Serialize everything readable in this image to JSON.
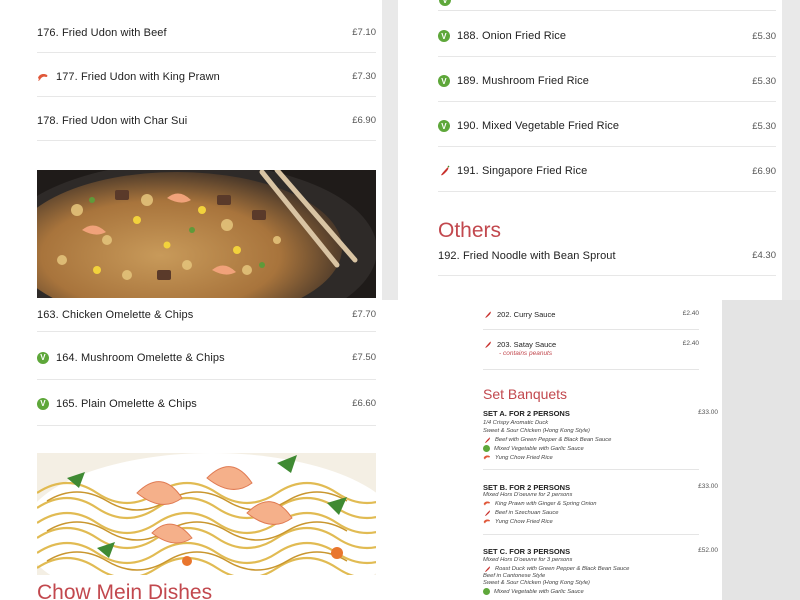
{
  "panel_left": {
    "items_top": [
      {
        "name": "176. Fried Udon with Beef",
        "price": "£7.10",
        "icon": ""
      },
      {
        "name": "177. Fried Udon with King Prawn",
        "price": "£7.30",
        "icon": "prawn-icon"
      },
      {
        "name": "178. Fried Udon with Char Sui",
        "price": "£6.90",
        "icon": ""
      }
    ],
    "items_bottom": [
      {
        "name": "163. Chicken Omelette & Chips",
        "price": "£7.70",
        "icon": ""
      },
      {
        "name": "164. Mushroom Omelette & Chips",
        "price": "£7.50",
        "icon": "vegetarian-icon"
      },
      {
        "name": "165. Plain Omelette & Chips",
        "price": "£6.60",
        "icon": "vegetarian-icon"
      }
    ],
    "section_title": "Chow Mein Dishes"
  },
  "panel_right": {
    "items": [
      {
        "name": "188. Onion Fried Rice",
        "price": "£5.30",
        "icon": "vegetarian-icon"
      },
      {
        "name": "189. Mushroom Fried Rice",
        "price": "£5.30",
        "icon": "vegetarian-icon"
      },
      {
        "name": "190. Mixed Vegetable Fried Rice",
        "price": "£5.30",
        "icon": "vegetarian-icon"
      },
      {
        "name": "191. Singapore Fried Rice",
        "price": "£6.90",
        "icon": "chili-icon"
      }
    ],
    "section_title": "Others",
    "others_items": [
      {
        "name": "192. Fried Noodle with Bean Sprout",
        "price": "£4.30"
      }
    ]
  },
  "panel_small": {
    "sauces": [
      {
        "name": "202. Curry Sauce",
        "price": "£2.40",
        "note": ""
      },
      {
        "name": "203. Satay Sauce",
        "price": "£2.40",
        "note": "- contains peanuts"
      }
    ],
    "section_title": "Set Banquets",
    "banquets": [
      {
        "title": "SET A. FOR 2 PERSONS",
        "price": "£33.00",
        "lines": [
          {
            "text": "1/4 Crispy Aromatic Duck",
            "icon": ""
          },
          {
            "text": "Sweet & Sour Chicken (Hong Kong Style)",
            "icon": ""
          },
          {
            "text": "Beef with Green Pepper & Black Bean Sauce",
            "icon": "chili-icon"
          },
          {
            "text": "Mixed Vegetable with Garlic Sauce",
            "icon": "vegetarian-icon"
          },
          {
            "text": "Yung Chow Fried Rice",
            "icon": "prawn-icon"
          }
        ]
      },
      {
        "title": "SET B. FOR 2 PERSONS",
        "price": "£33.00",
        "lines": [
          {
            "text": "Mixed Hors D'oeuvre for 2 persons",
            "icon": ""
          },
          {
            "text": "King Prawn with Ginger & Spring Onion",
            "icon": "prawn-icon"
          },
          {
            "text": "Beef in Szechuan Sauce",
            "icon": "chili-icon"
          },
          {
            "text": "Yung Chow Fried Rice",
            "icon": "prawn-icon"
          }
        ]
      },
      {
        "title": "SET C. FOR 3 PERSONS",
        "price": "£52.00",
        "lines": [
          {
            "text": "Mixed Hors D'oeuvre for 3 persons",
            "icon": ""
          },
          {
            "text": "Roast Duck with Green Pepper & Black Bean Sauce",
            "icon": "chili-icon"
          },
          {
            "text": "Beef in Cantonese Style",
            "icon": ""
          },
          {
            "text": "Sweet & Sour Chicken (Hong Kong Style)",
            "icon": ""
          },
          {
            "text": "Mixed Vegetable with Garlic Sauce",
            "icon": "vegetarian-icon"
          }
        ]
      }
    ]
  },
  "colors": {
    "accent": "#c2484e",
    "vegetarian": "#5ea73a",
    "chili": "#c8302c",
    "prawn": "#e0583a"
  }
}
